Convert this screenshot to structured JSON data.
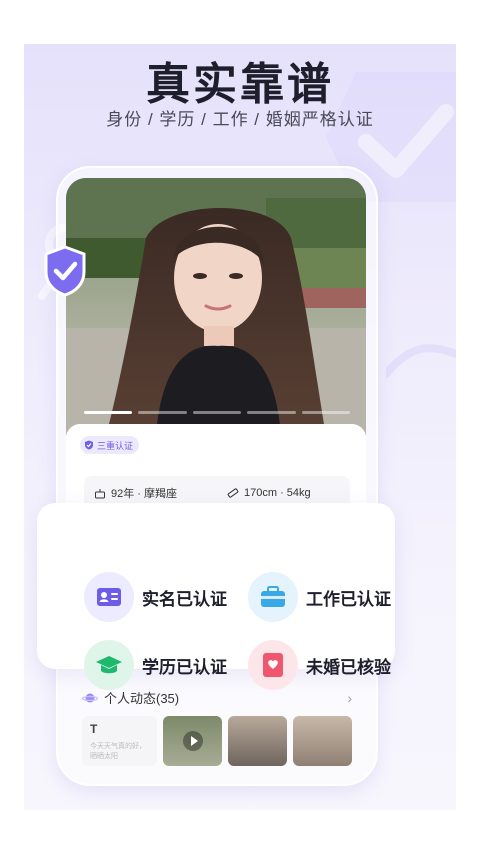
{
  "hero": {
    "title": "真实靠谱",
    "subtitle": "身份 / 学历 / 工作 / 婚姻严格认证"
  },
  "profile": {
    "badge_label": "三重认证",
    "age_sign": "92年 · 摩羯座",
    "height_weight": "170cm · 54kg",
    "photo_indicator": {
      "count": 5,
      "active_index": 0
    }
  },
  "verifications": [
    {
      "label": "实名已认证",
      "icon": "id-card-icon",
      "color": "#6c5ce7",
      "bg": "#ecebff"
    },
    {
      "label": "工作已认证",
      "icon": "briefcase-icon",
      "color": "#3aa8e6",
      "bg": "#e4f3fc"
    },
    {
      "label": "学历已认证",
      "icon": "graduation-cap-icon",
      "color": "#1fb86e",
      "bg": "#dff5e9"
    },
    {
      "label": "未婚已核验",
      "icon": "heart-certificate-icon",
      "color": "#f0566e",
      "bg": "#fde6ea"
    }
  ],
  "moments": {
    "title": "个人动态(35)",
    "text_post": {
      "initial": "T",
      "preview": "今天天气真的好，晒晒太阳"
    }
  },
  "colors": {
    "accent": "#6e5ee8",
    "background": "#e9e6fb"
  }
}
